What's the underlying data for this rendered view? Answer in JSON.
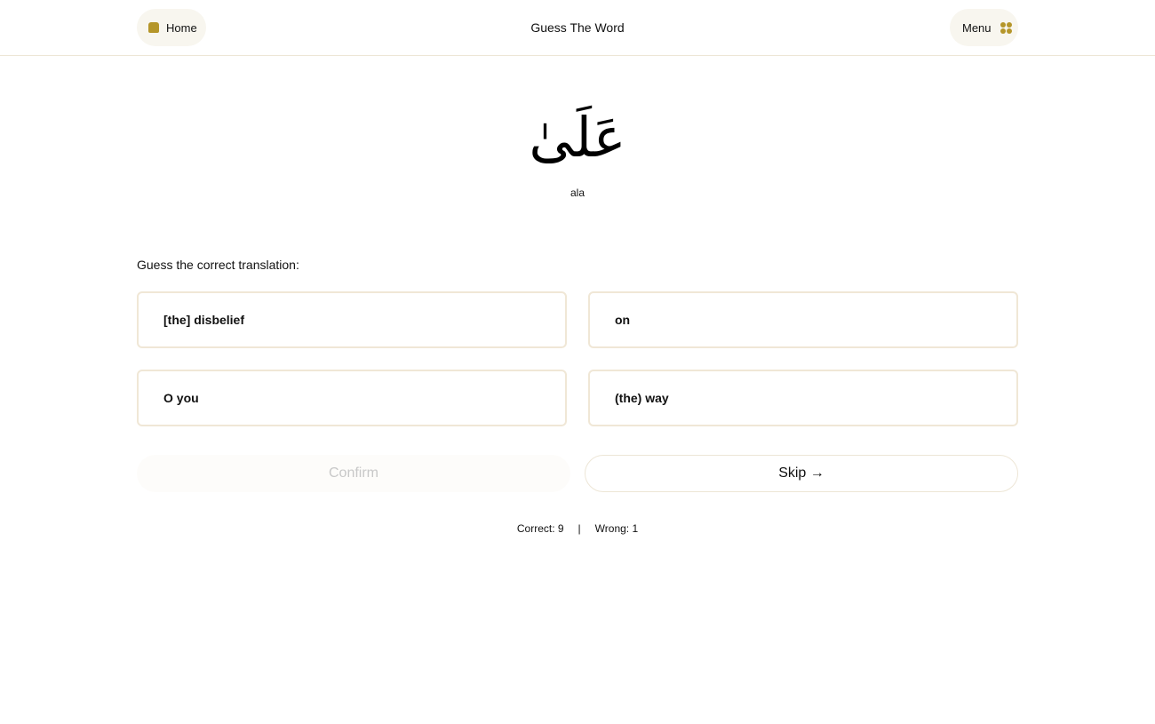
{
  "header": {
    "home_label": "Home",
    "title": "Guess The Word",
    "menu_label": "Menu",
    "home_icon": "home-icon",
    "menu_icon": "grid-icon",
    "accent_color": "#b5962a"
  },
  "word": {
    "arabic": "عَلَىٰ",
    "transliteration": "ala"
  },
  "quiz": {
    "prompt": "Guess the correct translation:",
    "options": [
      "[the] disbelief",
      "on",
      "O you",
      "(the) way"
    ],
    "confirm_label": "Confirm",
    "skip_label": "Skip →"
  },
  "score": {
    "correct": "Correct: 9",
    "separator": "|",
    "wrong": "Wrong: 1"
  }
}
